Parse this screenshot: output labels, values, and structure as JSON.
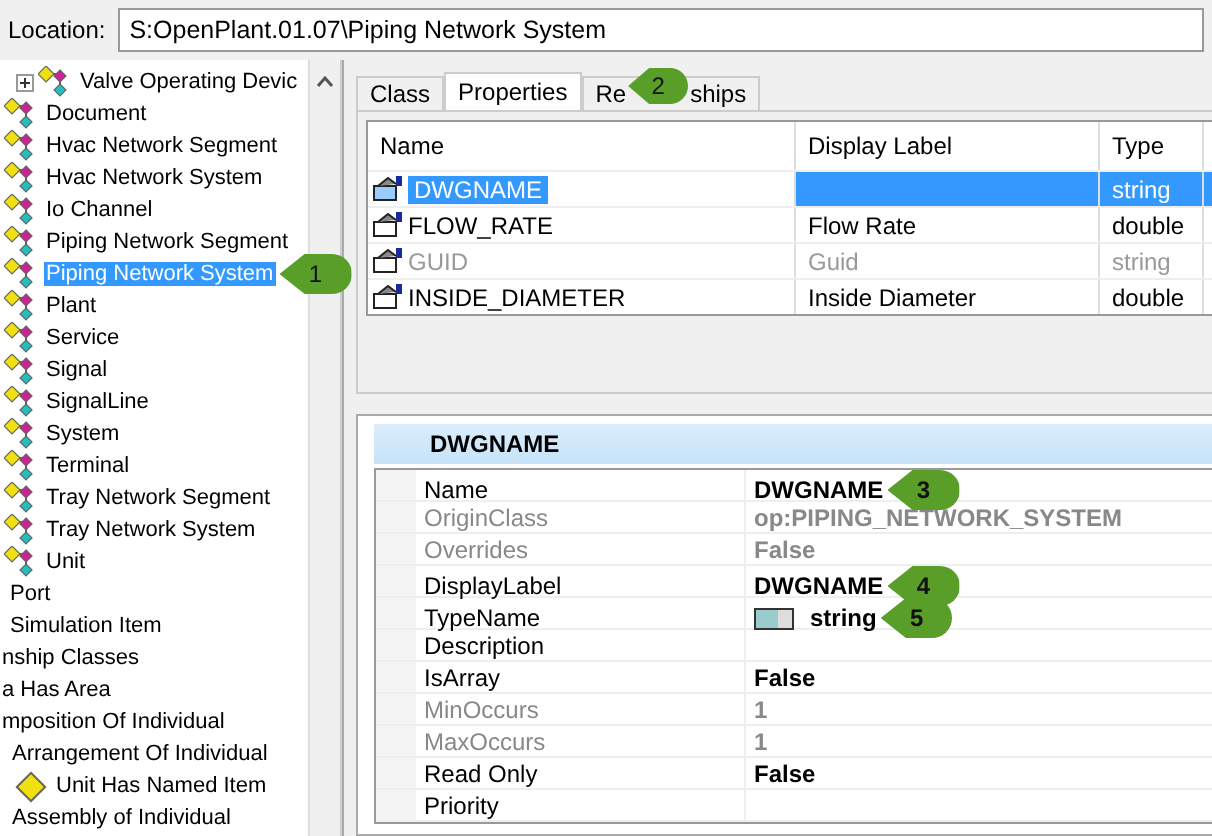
{
  "location": {
    "label": "Location:",
    "value": "S:OpenPlant.01.07\\Piping Network System"
  },
  "tree": {
    "items": [
      {
        "label": "Valve Operating Devic",
        "kind": "expandable-class",
        "selected": false
      },
      {
        "label": "Document",
        "kind": "class",
        "selected": false
      },
      {
        "label": "Hvac Network Segment",
        "kind": "class",
        "selected": false
      },
      {
        "label": "Hvac Network System",
        "kind": "class",
        "selected": false
      },
      {
        "label": "Io Channel",
        "kind": "class",
        "selected": false
      },
      {
        "label": "Piping Network Segment",
        "kind": "class",
        "selected": false
      },
      {
        "label": "Piping Network System",
        "kind": "class",
        "selected": true,
        "callout": "1"
      },
      {
        "label": "Plant",
        "kind": "class",
        "selected": false
      },
      {
        "label": "Service",
        "kind": "class",
        "selected": false
      },
      {
        "label": "Signal",
        "kind": "class",
        "selected": false
      },
      {
        "label": "SignalLine",
        "kind": "class",
        "selected": false
      },
      {
        "label": "System",
        "kind": "class",
        "selected": false
      },
      {
        "label": "Terminal",
        "kind": "class",
        "selected": false
      },
      {
        "label": "Tray Network Segment",
        "kind": "class",
        "selected": false
      },
      {
        "label": "Tray Network System",
        "kind": "class",
        "selected": false
      },
      {
        "label": "Unit",
        "kind": "class",
        "selected": false
      },
      {
        "label": "Port",
        "kind": "plain",
        "selected": false
      },
      {
        "label": "Simulation Item",
        "kind": "plain",
        "selected": false
      },
      {
        "label": "nship Classes",
        "kind": "cut",
        "selected": false
      },
      {
        "label": "a Has Area",
        "kind": "cut",
        "selected": false
      },
      {
        "label": "mposition Of Individual",
        "kind": "cut",
        "selected": false,
        "children": [
          {
            "label": "Arrangement Of Individual",
            "kind": "plain",
            "selected": false,
            "children": [
              {
                "label": "Unit Has Named Item",
                "kind": "named-item",
                "selected": false
              }
            ]
          },
          {
            "label": "Assembly of Individual",
            "kind": "plain",
            "selected": false
          }
        ]
      }
    ]
  },
  "tabs": [
    {
      "label": "Class",
      "selected": false
    },
    {
      "label": "Properties",
      "selected": true
    },
    {
      "label_start": "Re",
      "label_end": "ships",
      "callout": "2",
      "selected": false
    }
  ],
  "table": {
    "columns": [
      "Name",
      "Display Label",
      "Type"
    ],
    "rows": [
      {
        "name": "DWGNAME",
        "display_label": "",
        "type": "string",
        "selected": true,
        "disabled": false
      },
      {
        "name": "FLOW_RATE",
        "display_label": "Flow Rate",
        "type": "double",
        "selected": false,
        "disabled": false
      },
      {
        "name": "GUID",
        "display_label": "Guid",
        "type": "string",
        "selected": false,
        "disabled": true
      },
      {
        "name": "INSIDE_DIAMETER",
        "display_label": "Inside Diameter",
        "type": "double",
        "selected": false,
        "disabled": false
      }
    ]
  },
  "property_grid": {
    "title": "DWGNAME",
    "rows": [
      {
        "label": "Name",
        "value": "DWGNAME",
        "disabled": false,
        "callout": "3"
      },
      {
        "label": "OriginClass",
        "value": "op:PIPING_NETWORK_SYSTEM",
        "disabled": true
      },
      {
        "label": "Overrides",
        "value": "False",
        "disabled": true
      },
      {
        "label": "DisplayLabel",
        "value": "DWGNAME",
        "disabled": false,
        "callout": "4"
      },
      {
        "label": "TypeName",
        "value": "string",
        "disabled": false,
        "kind": "type",
        "callout": "5"
      },
      {
        "label": "Description",
        "disabled": false
      },
      {
        "label": "IsArray",
        "value": "False",
        "disabled": false
      },
      {
        "label": "MinOccurs",
        "value": "1",
        "disabled": true
      },
      {
        "label": "MaxOccurs",
        "value": "1",
        "disabled": true
      },
      {
        "label": "Read Only",
        "value": "False",
        "disabled": false
      },
      {
        "label": "Priority",
        "disabled": false
      }
    ]
  }
}
